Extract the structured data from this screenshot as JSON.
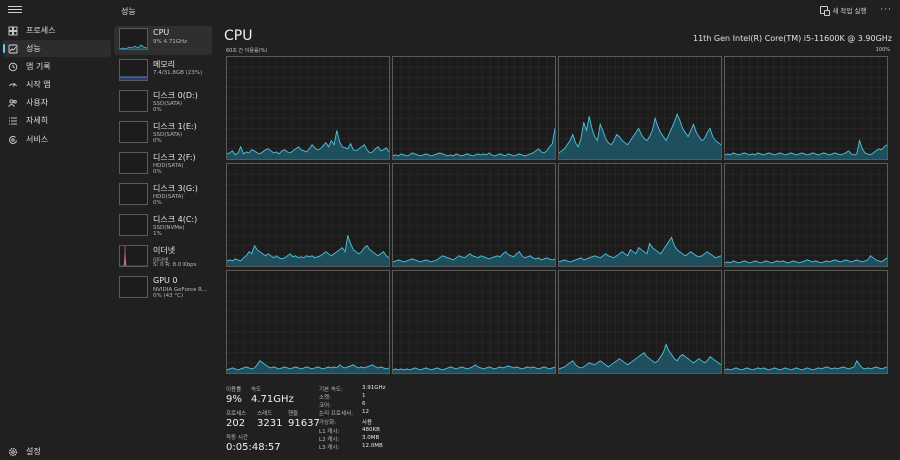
{
  "nav": {
    "items": [
      {
        "label": "프로세스",
        "icon": "processes-icon"
      },
      {
        "label": "성능",
        "icon": "performance-icon",
        "active": true
      },
      {
        "label": "앱 기록",
        "icon": "app-history-icon"
      },
      {
        "label": "시작 앱",
        "icon": "startup-apps-icon"
      },
      {
        "label": "사용자",
        "icon": "users-icon"
      },
      {
        "label": "자세히",
        "icon": "details-icon"
      },
      {
        "label": "서비스",
        "icon": "services-icon"
      }
    ],
    "settings_label": "설정"
  },
  "header": {
    "title": "성능",
    "new_task_label": "새 작업 실행",
    "more_label": "···"
  },
  "resources": [
    {
      "name": "CPU",
      "sub1": "9% 4.71GHz",
      "sub2": "",
      "sub3": "",
      "selected": true,
      "kind": "cpu"
    },
    {
      "name": "메모리",
      "sub1": "7.4/31.8GB (23%)",
      "sub2": "",
      "sub3": "",
      "kind": "memory"
    },
    {
      "name": "디스크 0(D:)",
      "sub1": "SSD(SATA)",
      "sub2": "0%",
      "sub3": "",
      "kind": "disk"
    },
    {
      "name": "디스크 1(E:)",
      "sub1": "SSD(SATA)",
      "sub2": "0%",
      "sub3": "",
      "kind": "disk"
    },
    {
      "name": "디스크 2(F:)",
      "sub1": "HDD(SATA)",
      "sub2": "0%",
      "sub3": "",
      "kind": "disk"
    },
    {
      "name": "디스크 3(G:)",
      "sub1": "HDD(SATA)",
      "sub2": "0%",
      "sub3": "",
      "kind": "disk"
    },
    {
      "name": "디스크 4(C:)",
      "sub1": "SSD(NVMe)",
      "sub2": "1%",
      "sub3": "",
      "kind": "disk"
    },
    {
      "name": "이더넷",
      "sub1": "이더넷",
      "sub2": "S: 0 R: 8.0 Kbps",
      "sub3": "",
      "kind": "ethernet"
    },
    {
      "name": "GPU 0",
      "sub1": "NVIDIA GeForce R...",
      "sub2": "0% (43 °C)",
      "sub3": "",
      "kind": "gpu"
    }
  ],
  "main": {
    "title": "CPU",
    "cpu_model": "11th Gen Intel(R) Core(TM) i5-11600K @ 3.90GHz",
    "utilization_label": "60초 간 이용률(%)",
    "max_pct_label": "100%"
  },
  "stats": {
    "usage_label": "이용률",
    "usage_value": "9%",
    "speed_label": "속도",
    "speed_value": "4.71GHz",
    "processes_label": "프로세스",
    "processes_value": "202",
    "threads_label": "스레드",
    "threads_value": "3231",
    "handles_label": "핸들",
    "handles_value": "91637",
    "uptime_label": "작동 시간",
    "uptime_value": "0:05:48:57"
  },
  "specs": [
    {
      "label": "기본 속도:",
      "value": "3.91GHz"
    },
    {
      "label": "소켓:",
      "value": "1"
    },
    {
      "label": "코어:",
      "value": "6"
    },
    {
      "label": "논리 프로세서:",
      "value": "12"
    },
    {
      "label": "가상화:",
      "value": "사용"
    },
    {
      "label": "L1 캐시:",
      "value": "480KB"
    },
    {
      "label": "L2 캐시:",
      "value": "3.0MB"
    },
    {
      "label": "L3 캐시:",
      "value": "12.0MB"
    }
  ],
  "colors": {
    "cpu_line": "#4fc3e0",
    "cpu_fill": "#1f4e5c",
    "memory_line": "#6aa0ff",
    "ethernet_line": "#e07a9e",
    "accent": "#60cdff"
  },
  "chart_data": {
    "type": "area",
    "title": "60초 간 이용률(%)",
    "ylim": [
      0,
      100
    ],
    "series": [
      {
        "values": [
          5,
          6,
          8,
          4,
          6,
          12,
          5,
          7,
          6,
          9,
          8,
          6,
          5,
          7,
          9,
          10,
          8,
          6,
          7,
          5,
          8,
          9,
          7,
          6,
          8,
          10,
          12,
          9,
          8,
          7,
          10,
          14,
          11,
          9,
          10,
          13,
          16,
          12,
          18,
          14,
          28,
          17,
          12,
          11,
          10,
          15,
          9,
          8,
          10,
          12,
          14,
          9,
          6,
          7,
          10,
          12,
          8,
          9,
          11,
          7
        ]
      },
      {
        "values": [
          3,
          4,
          3,
          5,
          4,
          3,
          4,
          6,
          5,
          4,
          3,
          4,
          5,
          4,
          3,
          4,
          5,
          6,
          5,
          4,
          3,
          4,
          3,
          5,
          4,
          3,
          4,
          5,
          4,
          3,
          4,
          5,
          4,
          5,
          4,
          6,
          4,
          3,
          4,
          5,
          4,
          3,
          5,
          4,
          3,
          4,
          5,
          4,
          3,
          4,
          5,
          6,
          8,
          10,
          7,
          6,
          8,
          12,
          15,
          30
        ]
      },
      {
        "values": [
          6,
          8,
          10,
          14,
          18,
          24,
          16,
          12,
          20,
          36,
          28,
          42,
          30,
          22,
          18,
          34,
          28,
          20,
          16,
          14,
          18,
          24,
          22,
          18,
          16,
          14,
          18,
          22,
          26,
          30,
          24,
          20,
          18,
          22,
          28,
          40,
          32,
          26,
          22,
          18,
          24,
          30,
          36,
          44,
          38,
          30,
          26,
          22,
          28,
          34,
          26,
          22,
          18,
          20,
          26,
          30,
          22,
          18,
          16,
          14
        ]
      },
      {
        "values": [
          4,
          5,
          4,
          6,
          5,
          4,
          5,
          6,
          5,
          4,
          5,
          4,
          6,
          5,
          4,
          5,
          6,
          5,
          4,
          5,
          6,
          5,
          4,
          5,
          6,
          5,
          4,
          5,
          6,
          5,
          4,
          5,
          6,
          5,
          4,
          5,
          6,
          5,
          4,
          5,
          6,
          5,
          4,
          5,
          6,
          8,
          5,
          4,
          5,
          18,
          10,
          6,
          5,
          4,
          6,
          8,
          10,
          9,
          12,
          14
        ]
      },
      {
        "values": [
          5,
          6,
          5,
          7,
          6,
          5,
          8,
          10,
          14,
          12,
          20,
          16,
          14,
          12,
          10,
          12,
          10,
          8,
          10,
          8,
          7,
          8,
          10,
          12,
          9,
          10,
          8,
          9,
          8,
          10,
          9,
          10,
          8,
          9,
          10,
          12,
          14,
          12,
          10,
          12,
          14,
          16,
          18,
          14,
          30,
          22,
          16,
          14,
          12,
          14,
          18,
          20,
          16,
          14,
          12,
          10,
          12,
          14,
          10,
          8
        ]
      },
      {
        "values": [
          4,
          5,
          6,
          5,
          4,
          5,
          6,
          7,
          6,
          5,
          4,
          5,
          6,
          5,
          4,
          5,
          6,
          8,
          10,
          9,
          8,
          7,
          6,
          8,
          10,
          9,
          8,
          10,
          12,
          10,
          9,
          8,
          10,
          9,
          8,
          7,
          8,
          9,
          10,
          9,
          12,
          14,
          11,
          10,
          9,
          12,
          14,
          10,
          8,
          9,
          10,
          8,
          7,
          8,
          6,
          7,
          8,
          7,
          6,
          7
        ]
      },
      {
        "values": [
          4,
          5,
          6,
          5,
          4,
          5,
          6,
          7,
          8,
          6,
          7,
          8,
          9,
          10,
          9,
          8,
          10,
          12,
          10,
          9,
          8,
          10,
          12,
          14,
          12,
          10,
          16,
          14,
          12,
          18,
          16,
          14,
          12,
          22,
          18,
          16,
          14,
          12,
          16,
          20,
          24,
          28,
          20,
          16,
          14,
          12,
          10,
          12,
          14,
          12,
          10,
          9,
          10,
          12,
          14,
          12,
          10,
          8,
          9,
          10
        ]
      },
      {
        "values": [
          3,
          4,
          3,
          5,
          4,
          3,
          4,
          5,
          4,
          3,
          4,
          5,
          4,
          3,
          4,
          5,
          4,
          3,
          4,
          5,
          4,
          5,
          4,
          3,
          4,
          5,
          4,
          3,
          4,
          5,
          6,
          5,
          4,
          5,
          4,
          3,
          4,
          5,
          4,
          5,
          6,
          5,
          4,
          5,
          6,
          5,
          4,
          5,
          6,
          5,
          4,
          5,
          6,
          10,
          8,
          6,
          5,
          4,
          6,
          8
        ]
      },
      {
        "values": [
          3,
          4,
          5,
          4,
          3,
          4,
          5,
          6,
          5,
          4,
          5,
          8,
          12,
          10,
          8,
          6,
          5,
          6,
          5,
          4,
          5,
          6,
          5,
          4,
          5,
          6,
          5,
          4,
          5,
          6,
          5,
          4,
          5,
          6,
          5,
          4,
          5,
          6,
          5,
          6,
          5,
          8,
          6,
          5,
          6,
          7,
          8,
          6,
          5,
          6,
          5,
          6,
          7,
          8,
          6,
          5,
          6,
          5,
          4,
          5
        ]
      },
      {
        "values": [
          3,
          4,
          3,
          4,
          3,
          4,
          3,
          4,
          5,
          4,
          3,
          4,
          5,
          4,
          3,
          4,
          5,
          4,
          3,
          4,
          5,
          6,
          5,
          4,
          5,
          6,
          5,
          4,
          5,
          6,
          8,
          6,
          5,
          4,
          5,
          6,
          5,
          4,
          5,
          6,
          5,
          6,
          7,
          6,
          5,
          6,
          5,
          4,
          5,
          6,
          5,
          6,
          5,
          4,
          5,
          6,
          5,
          4,
          5,
          6
        ]
      },
      {
        "values": [
          4,
          5,
          6,
          8,
          10,
          12,
          8,
          6,
          5,
          6,
          8,
          10,
          9,
          8,
          10,
          12,
          10,
          8,
          6,
          8,
          10,
          12,
          14,
          12,
          10,
          8,
          10,
          12,
          14,
          16,
          18,
          20,
          16,
          14,
          12,
          10,
          12,
          16,
          20,
          28,
          22,
          18,
          14,
          12,
          16,
          18,
          16,
          14,
          12,
          10,
          12,
          14,
          12,
          10,
          12,
          16,
          14,
          12,
          10,
          8
        ]
      },
      {
        "values": [
          3,
          4,
          3,
          4,
          5,
          4,
          3,
          4,
          5,
          4,
          3,
          4,
          5,
          4,
          5,
          4,
          3,
          4,
          5,
          4,
          3,
          4,
          5,
          4,
          3,
          4,
          5,
          4,
          3,
          4,
          5,
          4,
          3,
          4,
          5,
          4,
          5,
          6,
          5,
          4,
          5,
          4,
          5,
          6,
          5,
          4,
          5,
          6,
          12,
          8,
          5,
          4,
          5,
          4,
          5,
          6,
          5,
          4,
          5,
          6
        ]
      }
    ]
  }
}
